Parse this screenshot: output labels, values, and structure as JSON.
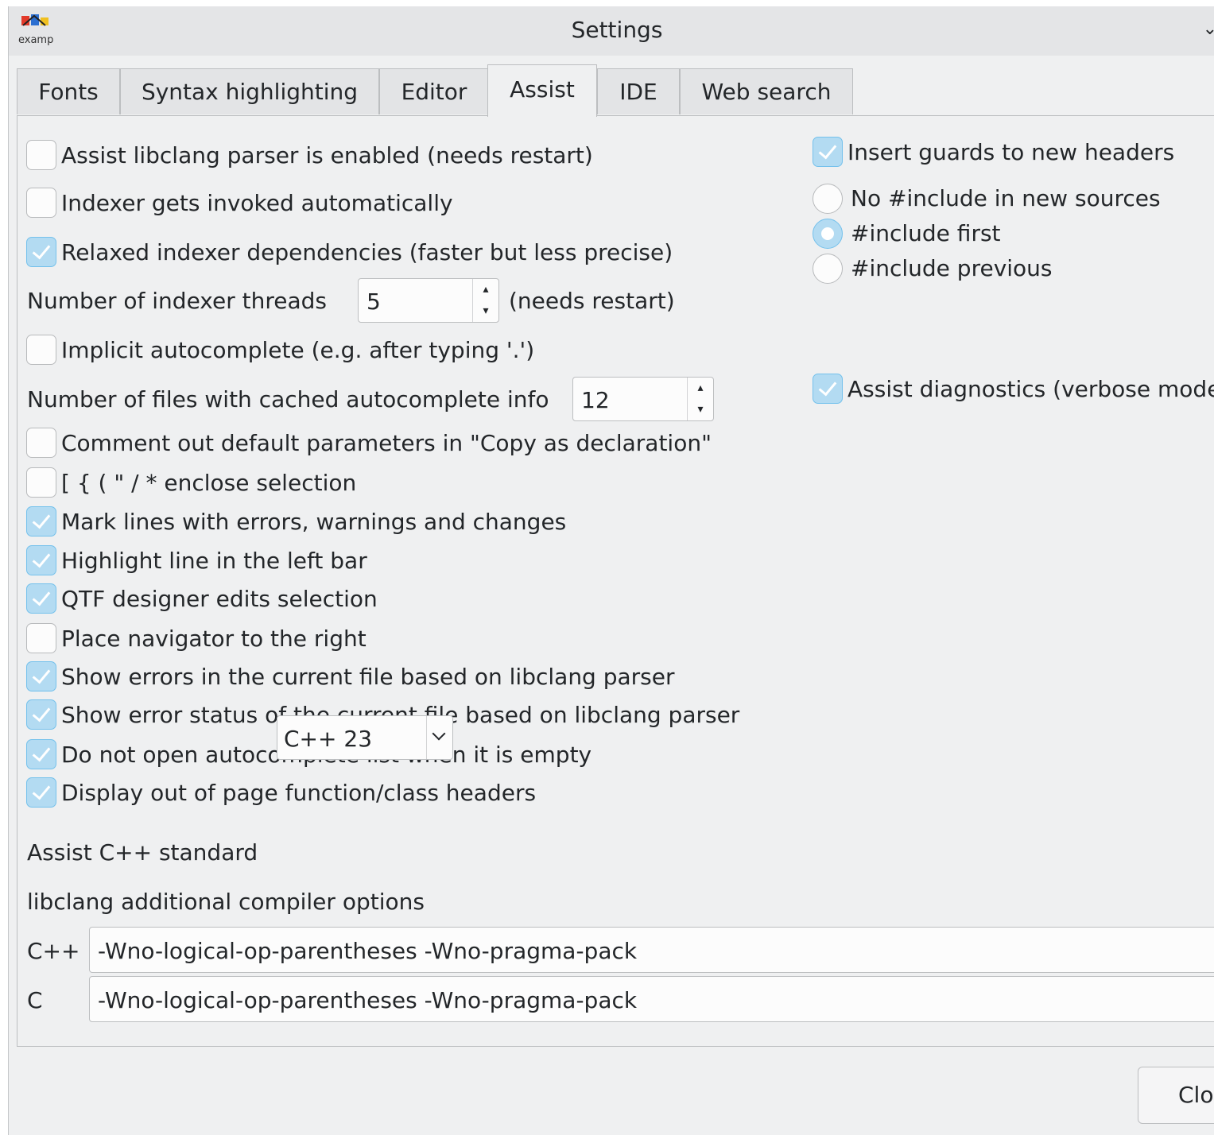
{
  "window": {
    "title": "Settings",
    "app_icon_text": "examp"
  },
  "tabs": [
    "Fonts",
    "Syntax highlighting",
    "Editor",
    "Assist",
    "IDE",
    "Web search"
  ],
  "active_tab": "Assist",
  "left": {
    "assist_libclang": {
      "label": "Assist libclang parser is enabled (needs restart)",
      "checked": false
    },
    "indexer_auto": {
      "label": "Indexer gets invoked automatically",
      "checked": false
    },
    "relaxed_deps": {
      "label": "Relaxed indexer dependencies (faster but less precise)",
      "checked": true
    },
    "indexer_threads": {
      "label": "Number of indexer threads",
      "value": "5",
      "suffix": "(needs restart)"
    },
    "implicit_autocomplete": {
      "label": "Implicit autocomplete (e.g. after typing '.')",
      "checked": false
    },
    "cached_files": {
      "label": "Number of files with cached autocomplete info",
      "value": "12"
    },
    "comment_default_params": {
      "label": "Comment out default parameters in \"Copy as declaration\"",
      "checked": false
    },
    "enclose_selection": {
      "label": "[ { ( \" / * enclose selection",
      "checked": false
    },
    "mark_lines": {
      "label": "Mark lines with errors, warnings and changes",
      "checked": true
    },
    "highlight_line": {
      "label": "Highlight line in the left bar",
      "checked": true
    },
    "qtf_designer": {
      "label": "QTF designer edits selection",
      "checked": true
    },
    "navigator_right": {
      "label": "Place navigator to the right",
      "checked": false
    },
    "show_errors": {
      "label": "Show errors in the current file based on libclang parser",
      "checked": true
    },
    "show_error_status": {
      "label": "Show error status of the current file based on libclang parser",
      "checked": true
    },
    "no_empty_autocomplete": {
      "label": "Do not open autocomplete list when it is empty",
      "checked": true
    },
    "out_of_page_headers": {
      "label": "Display out of page function/class headers",
      "checked": true
    },
    "cpp_standard": {
      "label": "Assist C++ standard",
      "value": "C++ 23"
    },
    "compiler_options": {
      "heading": "libclang additional compiler options",
      "cpp_label": "C++",
      "cpp_value": "-Wno-logical-op-parentheses -Wno-pragma-pack",
      "c_label": "C",
      "c_value": "-Wno-logical-op-parentheses -Wno-pragma-pack"
    }
  },
  "right": {
    "insert_guards": {
      "label": "Insert guards to new headers",
      "checked": true
    },
    "include_options": [
      {
        "label": "No #include in new sources",
        "selected": false
      },
      {
        "label": "#include first",
        "selected": true
      },
      {
        "label": "#include previous",
        "selected": false
      }
    ],
    "assist_diagnostics": {
      "label": "Assist diagnostics (verbose mode)",
      "checked": true
    }
  },
  "footer": {
    "close_label": "Close"
  },
  "icons": {
    "spin_up": "▴",
    "spin_down": "▾"
  }
}
